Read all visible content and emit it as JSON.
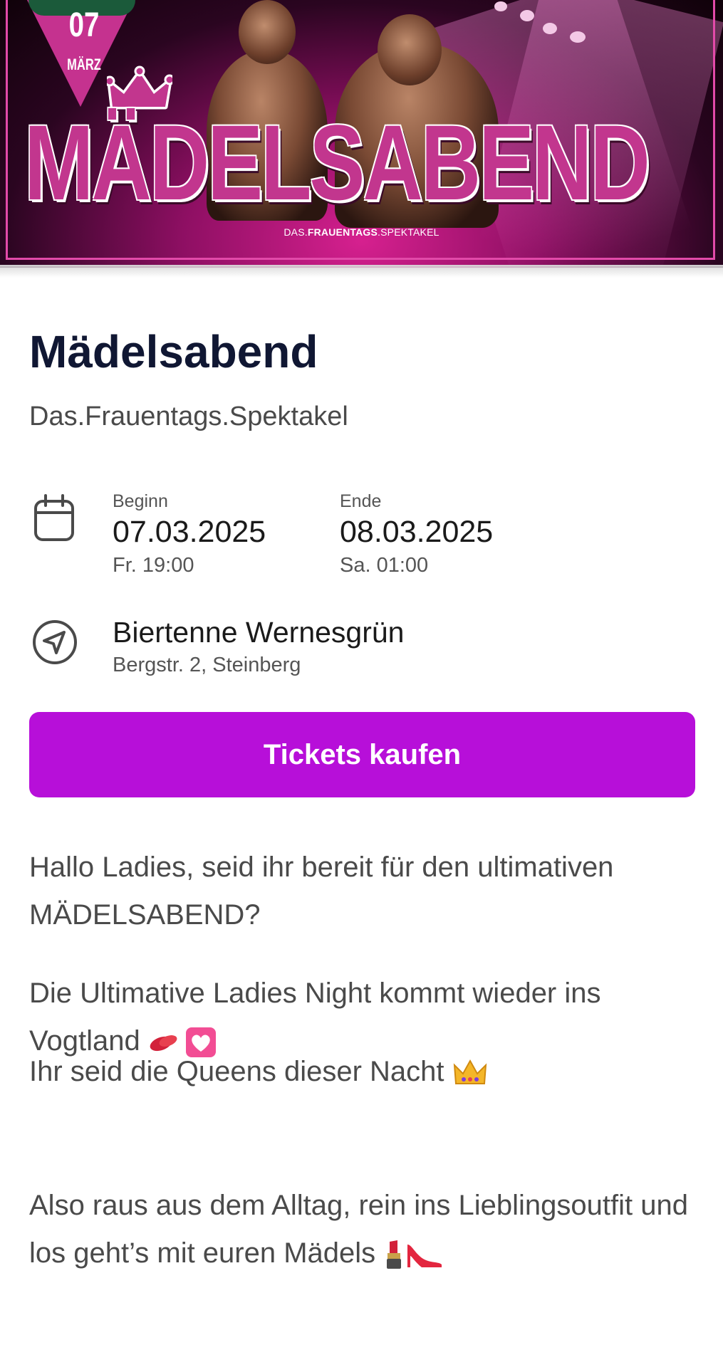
{
  "banner": {
    "badge_day": "07",
    "badge_month": "MÄRZ",
    "headline": "MÄDELSABEND",
    "sub_prefix": "DAS.",
    "sub_bold": "FRAUENTAGS",
    "sub_suffix": ".SPEKTAKEL"
  },
  "event": {
    "title": "Mädelsabend",
    "subtitle": "Das.Frauentags.Spektakel"
  },
  "dates": {
    "begin_label": "Beginn",
    "begin_date": "07.03.2025",
    "begin_time": "Fr. 19:00",
    "end_label": "Ende",
    "end_date": "08.03.2025",
    "end_time": "Sa. 01:00"
  },
  "location": {
    "venue": "Biertenne Wernesgrün",
    "address": "Bergstr. 2, Steinberg"
  },
  "cta": {
    "label": "Tickets kaufen",
    "color": "#b70fd9"
  },
  "description": [
    "Hallo Ladies, seid ihr bereit für den ultimativen MÄDELSABEND?",
    "Die Ultimative Ladies Night kommt wieder ins Vogtland",
    "Ihr seid die Queens dieser Nacht",
    "Also raus aus dem Alltag, rein ins Lieblingsoutfit und los geht’s mit euren Mädels"
  ],
  "icons": {
    "calendar": "calendar-icon",
    "location": "navigation-arrow-icon",
    "kiss": "kiss-mark-emoji",
    "heart": "pink-heart-emoji",
    "crown": "crown-emoji",
    "lipstick": "lipstick-emoji",
    "heel": "high-heel-emoji"
  }
}
